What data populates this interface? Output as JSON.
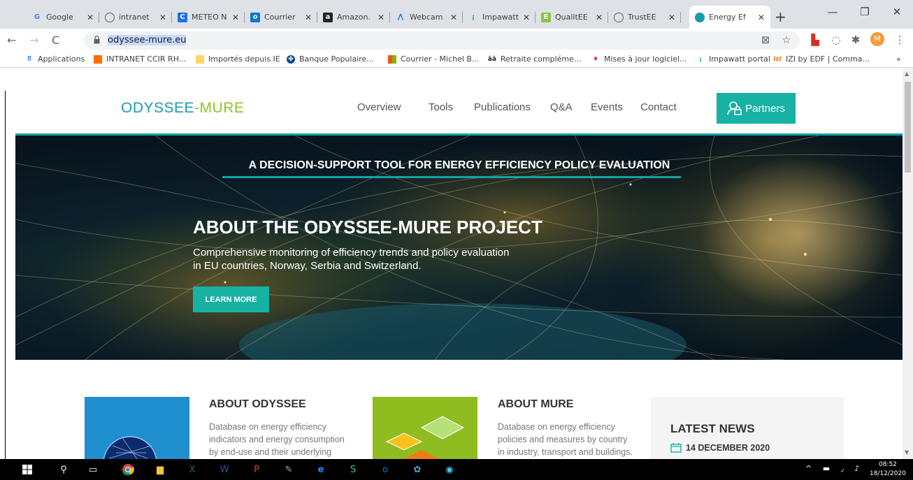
{
  "tabs": [
    {
      "title": "Google",
      "icon": "google-icon",
      "color": "#4285f4"
    },
    {
      "title": "intranet",
      "icon": "globe-icon",
      "color": "#5f6368"
    },
    {
      "title": "METEO N",
      "icon": "meteo-icon",
      "color": "#1a73e8"
    },
    {
      "title": "Courrier",
      "icon": "outlook-icon",
      "color": "#0078d4"
    },
    {
      "title": "Amazon.",
      "icon": "amazon-icon",
      "color": "#222"
    },
    {
      "title": "Webcam",
      "icon": "webcam-icon",
      "color": "#1a73e8"
    },
    {
      "title": "Impawatt",
      "icon": "impawatt-icon",
      "color": "#34a853"
    },
    {
      "title": "QualitEE",
      "icon": "qualitee-icon",
      "color": "#8bc34a",
      "badge": "1"
    },
    {
      "title": "TrustEE",
      "icon": "trustee-icon",
      "color": "#5f6368"
    },
    {
      "title": "Energy Ef",
      "icon": "energy-icon",
      "color": "#1a9ba9"
    }
  ],
  "toolbar": {
    "url": "odyssee-mure.eu",
    "avatar_letter": "M"
  },
  "bookmarks": [
    {
      "label": "Applications",
      "icon": "apps-grid-icon"
    },
    {
      "label": "INTRANET CCIR RH...",
      "icon": "intranet-icon"
    },
    {
      "label": "Importés depuis IE",
      "icon": "folder-icon"
    },
    {
      "label": "Banque Populaire...",
      "icon": "bank-icon"
    },
    {
      "label": "Courrier - Michel B...",
      "icon": "microsoft-icon"
    },
    {
      "label": "Retraite compléme...",
      "icon": "retraite-icon"
    },
    {
      "label": "Mises à jour logiciel...",
      "icon": "update-icon"
    },
    {
      "label": "Impawatt portal",
      "icon": "impawatt-icon"
    },
    {
      "label": "IZI by EDF | Comma...",
      "icon": "izi-icon"
    }
  ],
  "bookmarks_more": "»",
  "site": {
    "logo_part1": "ODYSSEE",
    "logo_part2": "-MURE",
    "nav": [
      "Overview",
      "Tools",
      "Publications",
      "Q&A",
      "Events",
      "Contact"
    ],
    "partners_label": "Partners",
    "tagline": "A DECISION-SUPPORT TOOL FOR ENERGY EFFICIENCY POLICY EVALUATION",
    "hero_title": "ABOUT THE ODYSSEE-MURE PROJECT",
    "hero_sub_line1": "Comprehensive monitoring of efficiency trends and policy evaluation",
    "hero_sub_line2": "in EU countries, Norway, Serbia and Switzerland.",
    "learn_more": "LEARN MORE",
    "card1_title": "ABOUT ODYSSEE",
    "card1_text_line1": "Database on energy efficiency",
    "card1_text_line2": "indicators and energy consumption",
    "card1_text_line3": "by end-use and their underlying",
    "card2_title": "ABOUT MURE",
    "card2_text_line1": "Database on energy efficiency",
    "card2_text_line2": "policies and measures by country",
    "card2_text_line3": "in industry, transport and buildings.",
    "news_title": "LATEST NEWS",
    "news_date": "14 DECEMBER 2020"
  },
  "taskbar": {
    "time": "08:52",
    "date": "18/12/2020"
  },
  "colors": {
    "brand_teal": "#17b2a4",
    "brand_green": "#8fc424",
    "logo_teal": "#1a9ba9"
  }
}
